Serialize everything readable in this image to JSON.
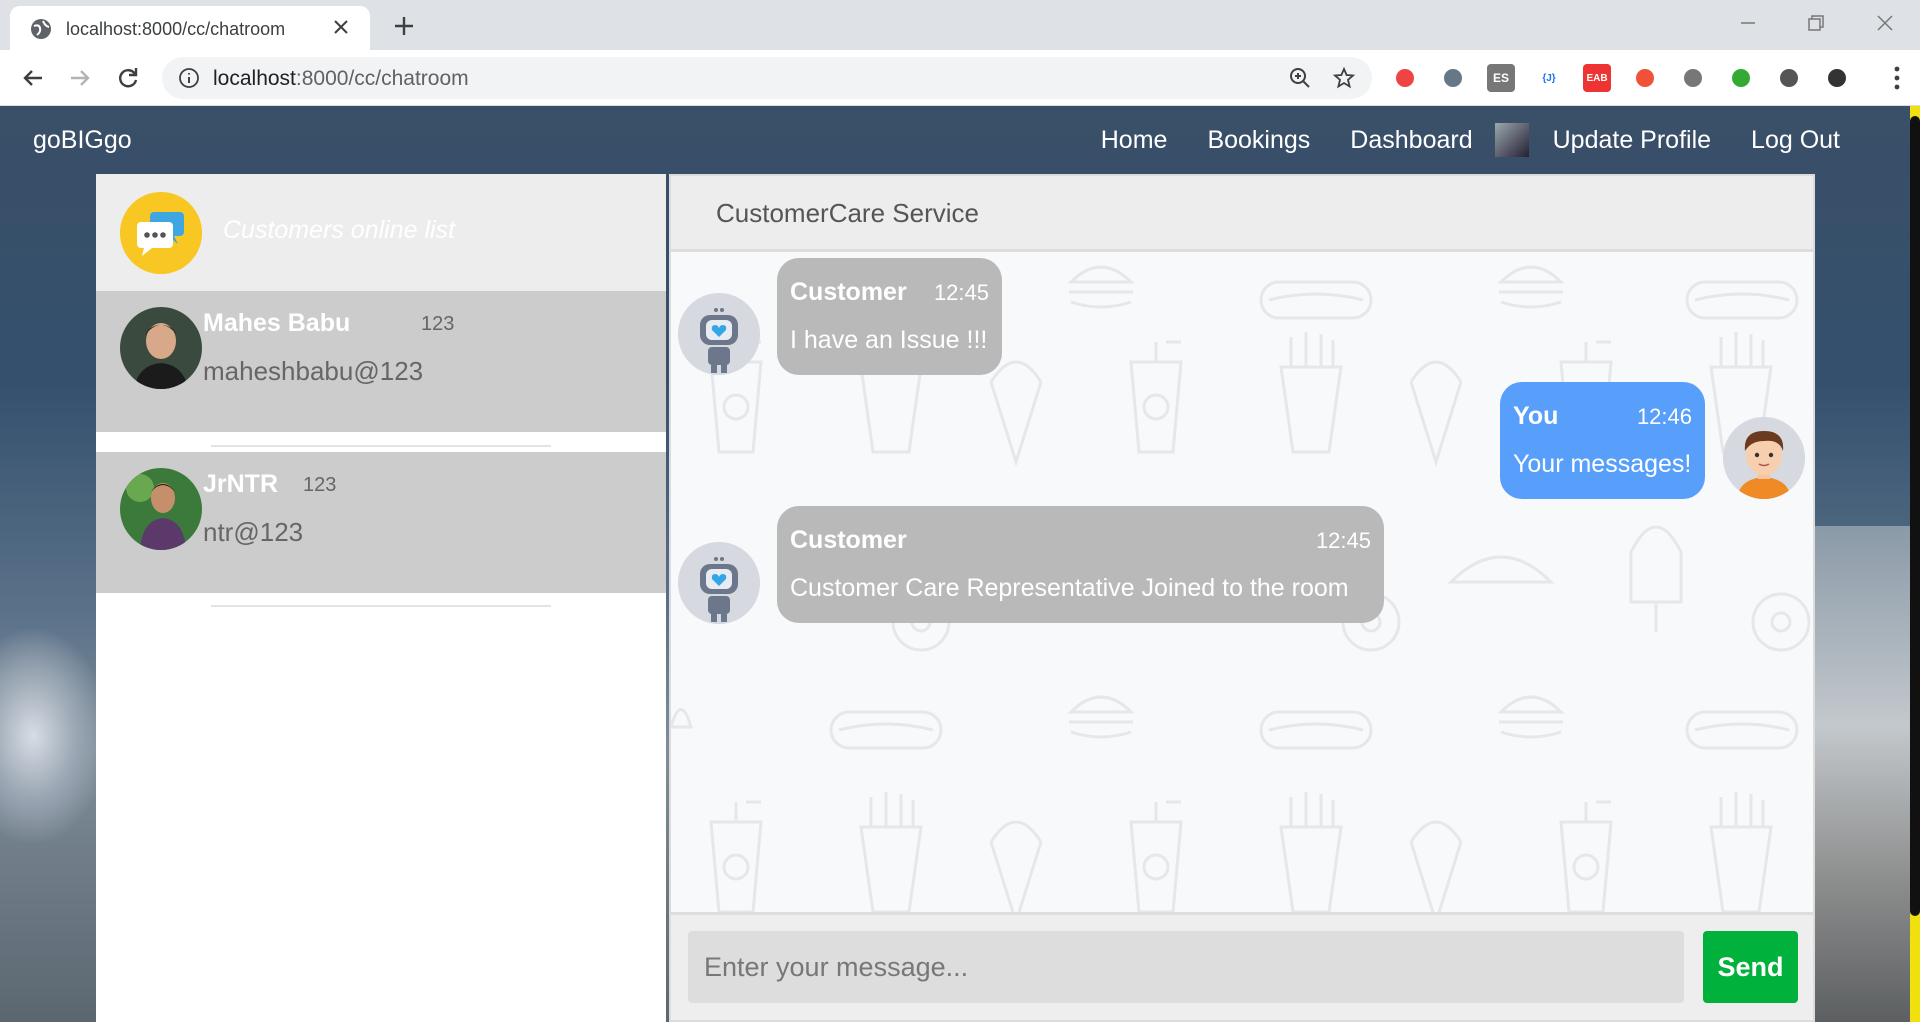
{
  "browser": {
    "tab_title": "localhost:8000/cc/chatroom",
    "url_host": "localhost",
    "url_rest": ":8000/cc/chatroom",
    "extensions": [
      {
        "name": "pocket-extension-icon",
        "label": "",
        "bg": "#fff",
        "fg": "#e44"
      },
      {
        "name": "drive-extension-icon",
        "label": "",
        "bg": "#fff",
        "fg": "#678"
      },
      {
        "name": "es-extension-icon",
        "label": "ES",
        "bg": "#777",
        "fg": "#fff"
      },
      {
        "name": "json-extension-icon",
        "label": "{J}",
        "bg": "#fff",
        "fg": "#1a73e8"
      },
      {
        "name": "eab-extension-icon",
        "label": "EAB",
        "bg": "#e33",
        "fg": "#fff"
      },
      {
        "name": "swift-extension-icon",
        "label": "",
        "bg": "#fff",
        "fg": "#f05138"
      },
      {
        "name": "search-page-extension-icon",
        "label": "",
        "bg": "#fff",
        "fg": "#777"
      },
      {
        "name": "globe-extension-icon",
        "label": "",
        "bg": "#fff",
        "fg": "#3a3"
      },
      {
        "name": "puzzle-extensions-icon",
        "label": "",
        "bg": "#fff",
        "fg": "#555"
      },
      {
        "name": "profile-avatar-icon",
        "label": "",
        "bg": "#fff",
        "fg": "#333"
      }
    ]
  },
  "nav": {
    "brand": "goBIGgo",
    "home": "Home",
    "bookings": "Bookings",
    "dashboard": "Dashboard",
    "update_profile": "Update Profile",
    "logout": "Log Out"
  },
  "left": {
    "title": "Customers online list",
    "contacts": [
      {
        "name": "Mahes Babu",
        "number": "123",
        "id": "maheshbabu@123"
      },
      {
        "name": "JrNTR",
        "number": "123",
        "id": "ntr@123"
      }
    ]
  },
  "chat": {
    "title": "CustomerCare Service",
    "messages": [
      {
        "sender": "Customer",
        "time": "12:45",
        "text": "I have an Issue !!!"
      },
      {
        "sender": "You",
        "time": "12:46",
        "text": "Your messages!"
      },
      {
        "sender": "Customer",
        "time": "12:45",
        "text": "Customer Care Representative Joined to the room"
      }
    ],
    "input_placeholder": "Enter your message...",
    "send_label": "Send"
  },
  "colors": {
    "accent_blue": "#579ffb",
    "bubble_gray": "#b9b9b9",
    "send_green": "#00b13c",
    "logo_yellow": "#f9c723"
  }
}
